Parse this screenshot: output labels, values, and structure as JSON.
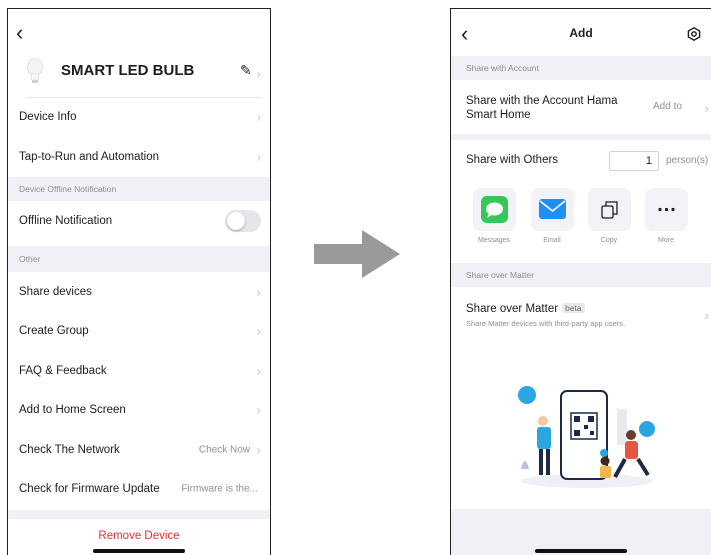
{
  "left": {
    "device_name": "SMART LED BULB",
    "rows": {
      "device_info": "Device Info",
      "tap_to_run": "Tap-to-Run and Automation",
      "offline_notification": "Offline Notification",
      "share_devices": "Share devices",
      "create_group": "Create Group",
      "faq": "FAQ & Feedback",
      "add_home": "Add to Home Screen",
      "check_network": "Check The Network",
      "check_network_value": "Check Now",
      "firmware": "Check for Firmware Update",
      "firmware_value": "Firmware is the..."
    },
    "sections": {
      "offline": "Device Offline Notification",
      "other": "Other"
    },
    "offline_toggle_on": false,
    "remove_label": "Remove Device",
    "remove_color": "#e0352f"
  },
  "right": {
    "title": "Add",
    "sections": {
      "account": "Share with Account",
      "matter": "Share over Matter"
    },
    "account_share_label": "Share with the Account Hama Smart Home",
    "account_add_to": "Add to",
    "others_label": "Share with Others",
    "others_count": "1",
    "others_unit": "person(s)",
    "share_options": [
      {
        "label": "Messages",
        "icon": "messages-icon",
        "color": "#34c759"
      },
      {
        "label": "Email",
        "icon": "email-icon",
        "color": "#1e90f5"
      },
      {
        "label": "Copy",
        "icon": "copy-icon",
        "color": "#1c1c1e"
      },
      {
        "label": "More",
        "icon": "more-icon",
        "color": "#1c1c1e"
      }
    ],
    "matter_label": "Share over Matter",
    "matter_badge": "beta",
    "matter_sub": "Share Matter devices with third-party app users."
  },
  "icons": {
    "back": "chevron-left-icon",
    "edit": "pencil-icon",
    "settings": "hexagon-gear-icon",
    "bulb": "bulb-icon",
    "flow_arrow": "right-arrow-icon"
  },
  "colors": {
    "section_bg": "#f0f1f7",
    "accent_blue": "#1e90f5",
    "illustration_accent": "#2aa7e0"
  }
}
